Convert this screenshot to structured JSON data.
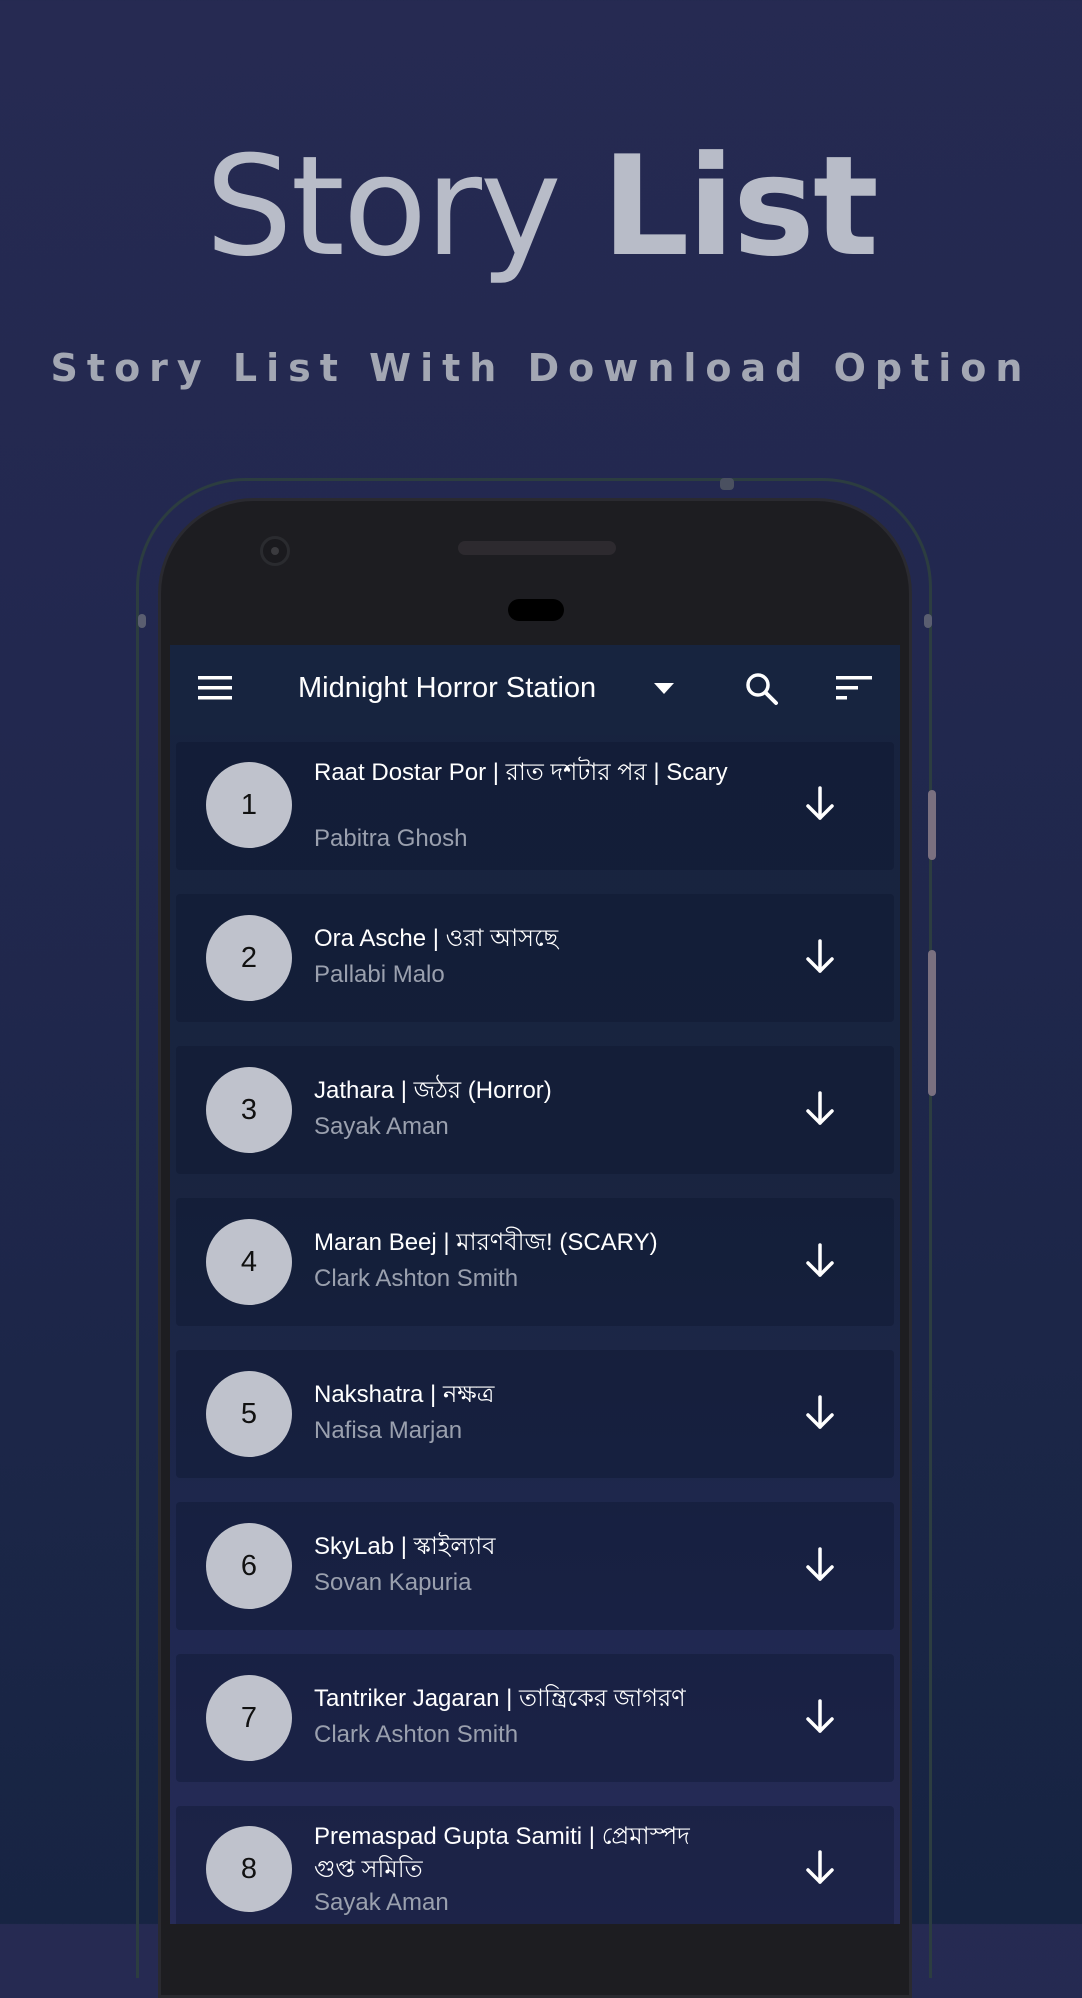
{
  "hero": {
    "title_light": "Story",
    "title_bold": "List",
    "subtitle": "Story List With Download Option"
  },
  "toolbar": {
    "menu_icon": "hamburger-menu-icon",
    "station_title": "Midnight Horror Station",
    "dropdown_icon": "dropdown-arrow-icon",
    "search_icon": "search-icon",
    "sort_icon": "sort-icon"
  },
  "stories": [
    {
      "number": "1",
      "title": "Raat Dostar Por | রাত দশটার পর | Scary",
      "author": "Pabitra Ghosh"
    },
    {
      "number": "2",
      "title": "Ora Asche | ওরা আসছে",
      "author": "Pallabi Malo"
    },
    {
      "number": "3",
      "title": "Jathara | জঠর (Horror)",
      "author": "Sayak Aman"
    },
    {
      "number": "4",
      "title": "Maran Beej | মারণবীজ! (SCARY)",
      "author": "Clark Ashton Smith"
    },
    {
      "number": "5",
      "title": "Nakshatra | নক্ষত্র",
      "author": "Nafisa Marjan"
    },
    {
      "number": "6",
      "title": "SkyLab | স্কাইল্যাব",
      "author": "Sovan Kapuria"
    },
    {
      "number": "7",
      "title": "Tantriker Jagaran | তান্ত্রিকের জাগরণ",
      "author": "Clark Ashton Smith"
    },
    {
      "number": "8",
      "title": "Premaspad Gupta Samiti | প্রেমাস্পদ গুপ্ত সমিতি",
      "author": "Sayak Aman"
    }
  ],
  "download_icon": "download-arrow-icon",
  "colors": {
    "background": "#22284f",
    "toolbar": "#17243f",
    "badge": "#bfc2cc",
    "author_text": "#9aa0ae",
    "hero_text": "#b8bcc8"
  }
}
